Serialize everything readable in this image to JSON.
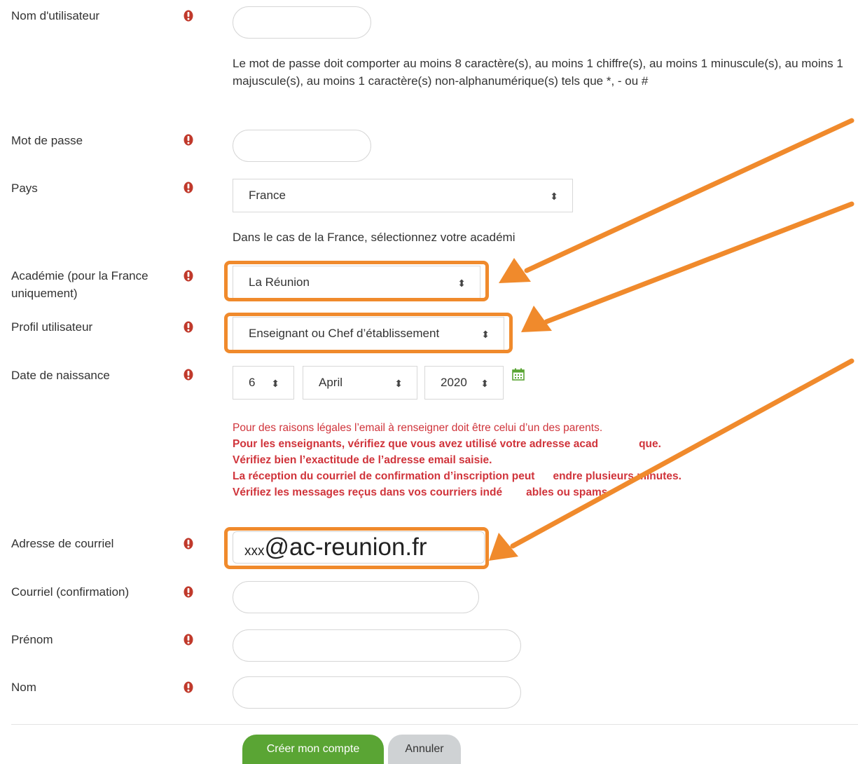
{
  "form": {
    "username": {
      "label": "Nom d'utilisateur",
      "value": ""
    },
    "password_hint": "Le mot de passe doit comporter au moins 8 caractère(s), au moins 1 chiffre(s), au moins 1 minuscule(s), au moins 1 majuscule(s), au moins 1 caractère(s) non-alphanumérique(s) tels que *, - ou #",
    "password": {
      "label": "Mot de passe",
      "value": ""
    },
    "country": {
      "label": "Pays",
      "value": "France"
    },
    "country_hint": "Dans le cas de la France, sélectionnez votre académi",
    "academy": {
      "label_line1": "Académie (pour la France",
      "label_line2": "uniquement)",
      "value": "La Réunion"
    },
    "profile": {
      "label": "Profil utilisateur",
      "value": "Enseignant ou Chef d’établissement"
    },
    "birthdate": {
      "label": "Date de naissance",
      "day": "6",
      "month": "April",
      "year": "2020"
    },
    "email_notes": [
      "Pour des raisons légales l’email à renseigner doit être celui d’un des parents.",
      "Pour les enseignants, vérifiez que vous avez utilisé votre adresse acad",
      "Vérifiez bien l’exactitude de l’adresse email saisie.",
      "La réception du courriel de confirmation d’inscription peut",
      "Vérifiez les messages reçus dans vos courriers indé"
    ],
    "email_notes_tail": [
      "",
      "que.",
      "",
      "endre plusieurs minutes.",
      "ables ou spams."
    ],
    "email": {
      "label": "Adresse de courriel",
      "value_prefix": "xxx",
      "value_main": "@ac-reunion.fr"
    },
    "email_confirm": {
      "label": "Courriel (confirmation)",
      "value": ""
    },
    "firstname": {
      "label": "Prénom",
      "value": ""
    },
    "lastname": {
      "label": "Nom",
      "value": ""
    }
  },
  "buttons": {
    "submit": "Créer mon compte",
    "cancel": "Annuler"
  },
  "select_arrow": "⬍",
  "colors": {
    "required_icon": "#c0392b",
    "warning_text": "#d0343b",
    "annotation_orange": "#f08a2c",
    "submit_green": "#5aa534",
    "cancel_grey": "#cfd2d4",
    "calendar_green": "#5aa534"
  }
}
